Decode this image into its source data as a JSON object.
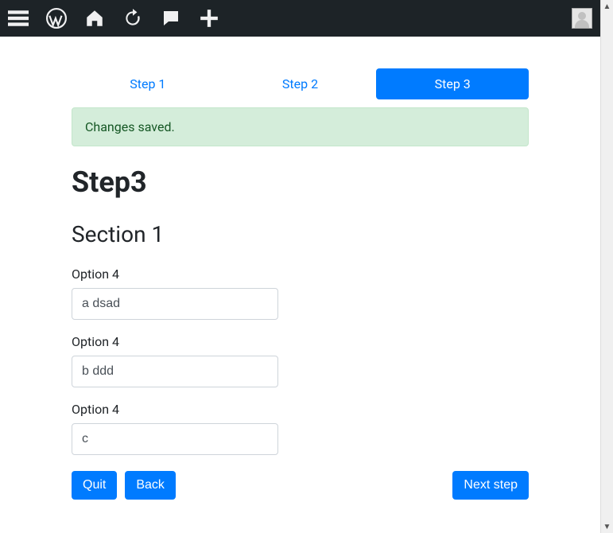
{
  "adminbar": {
    "icons": [
      "menu-icon",
      "wordpress-icon",
      "home-icon",
      "refresh-icon",
      "comment-icon",
      "plus-icon"
    ]
  },
  "steps": [
    {
      "label": "Step 1",
      "active": false
    },
    {
      "label": "Step 2",
      "active": false
    },
    {
      "label": "Step 3",
      "active": true
    }
  ],
  "alert": "Changes saved.",
  "page_title": "Step3",
  "section_title": "Section 1",
  "fields": [
    {
      "label": "Option 4",
      "value": "a dsad"
    },
    {
      "label": "Option 4",
      "value": "b ddd"
    },
    {
      "label": "Option 4",
      "value": "c"
    }
  ],
  "buttons": {
    "quit": "Quit",
    "back": "Back",
    "next": "Next step"
  }
}
